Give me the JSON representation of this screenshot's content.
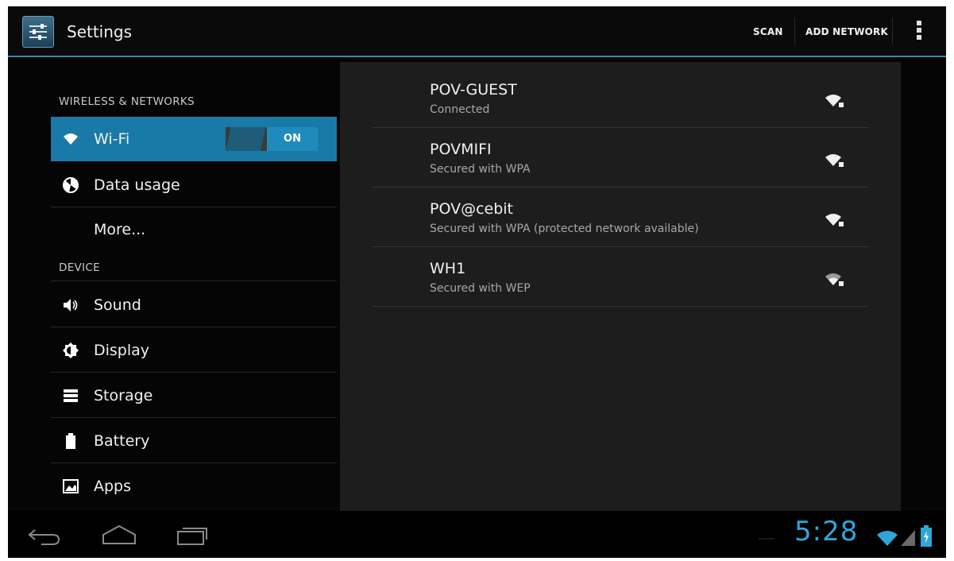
{
  "action_bar": {
    "title": "Settings",
    "icon": "settings-sliders-icon",
    "scan_label": "SCAN",
    "add_network_label": "ADD NETWORK",
    "overflow_icon": "overflow-menu-icon"
  },
  "sidebar": {
    "sections": [
      {
        "header": "WIRELESS & NETWORKS"
      },
      {
        "header": "DEVICE"
      }
    ],
    "items": [
      {
        "label": "Wi-Fi",
        "icon": "wifi-icon",
        "selected": true,
        "toggle": "ON"
      },
      {
        "label": "Data usage",
        "icon": "data-usage-icon"
      },
      {
        "label": "More...",
        "icon": ""
      },
      {
        "label": "Sound",
        "icon": "speaker-icon"
      },
      {
        "label": "Display",
        "icon": "brightness-icon"
      },
      {
        "label": "Storage",
        "icon": "storage-icon"
      },
      {
        "label": "Battery",
        "icon": "battery-icon"
      },
      {
        "label": "Apps",
        "icon": "apps-icon"
      }
    ]
  },
  "networks": [
    {
      "ssid": "POV-GUEST",
      "status": "Connected",
      "signal_icon": "wifi-signal-locked-icon"
    },
    {
      "ssid": "POVMIFI",
      "status": "Secured with WPA",
      "signal_icon": "wifi-signal-locked-icon"
    },
    {
      "ssid": "POV@cebit",
      "status": "Secured with WPA (protected network available)",
      "signal_icon": "wifi-signal-locked-icon"
    },
    {
      "ssid": "WH1",
      "status": "Secured with WEP",
      "signal_icon": "wifi-signal-locked-icon"
    }
  ],
  "status_bar": {
    "time": "5:28",
    "icons": [
      "wifi-status-icon",
      "cell-signal-icon",
      "battery-charging-icon"
    ]
  },
  "nav_bar": {
    "icons": [
      "back-icon",
      "home-icon",
      "recent-apps-icon"
    ]
  },
  "colors": {
    "accent": "#197aa8",
    "clock": "#2fa6d8",
    "toggle_on": "#1f8bbd"
  }
}
